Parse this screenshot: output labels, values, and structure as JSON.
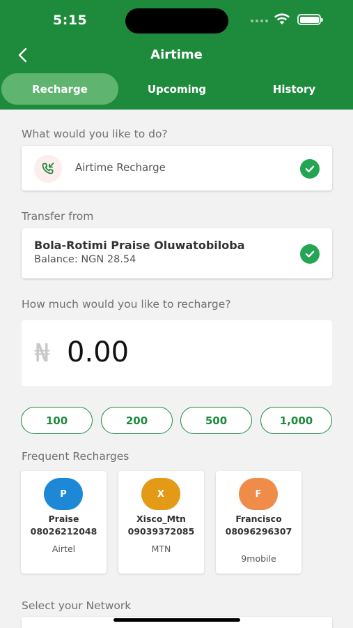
{
  "status_bar": {
    "time": "5:15"
  },
  "header": {
    "title": "Airtime"
  },
  "tabs": [
    {
      "label": "Recharge",
      "active": true
    },
    {
      "label": "Upcoming",
      "active": false
    },
    {
      "label": "History",
      "active": false
    }
  ],
  "operation": {
    "label": "What would you like to do?",
    "value": "Airtime Recharge",
    "icon": "phone-incoming-icon"
  },
  "transfer": {
    "label": "Transfer from",
    "account_name": "Bola-Rotimi Praise Oluwatobiloba",
    "balance": "Balance: NGN 28.54"
  },
  "amount": {
    "label": "How much would you like to recharge?",
    "currency_symbol": "₦",
    "value": "0.00"
  },
  "quick_amounts": [
    "100",
    "200",
    "500",
    "1,000"
  ],
  "frequent": {
    "label": "Frequent Recharges",
    "items": [
      {
        "initial": "P",
        "name": "Praise",
        "number": "08026212048",
        "network": "Airtel",
        "color": "#1d88d6"
      },
      {
        "initial": "X",
        "name": "Xisco_Mtn",
        "number": "09039372085",
        "network": "MTN",
        "color": "#e39a17"
      },
      {
        "initial": "F",
        "name": "Francisco",
        "number": "08096296307",
        "network": "9mobile",
        "color": "#ef8c4a"
      }
    ]
  },
  "network": {
    "label": "Select your Network"
  },
  "colors": {
    "brand_green": "#1e8a3c",
    "active_tab": "#5fb56f",
    "check_green": "#23a554"
  }
}
